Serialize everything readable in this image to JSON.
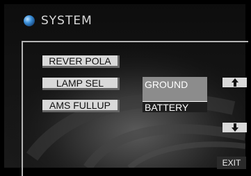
{
  "header": {
    "icon": "sphere-icon",
    "title": "SYSTEM"
  },
  "menu": {
    "rever_pola": "REVER POLA",
    "lamp_sel": "LAMP SEL",
    "ams_fullup": "AMS FULLUP"
  },
  "lamp_options": {
    "ground": "GROUND",
    "battery": "BATTERY"
  },
  "nav": {
    "up_icon": "arrow-up-icon",
    "down_icon": "arrow-down-icon",
    "exit": "EXIT"
  },
  "colors": {
    "accent_blue": "#3a8fd9",
    "button_bg": "#d9d9d9",
    "highlight": "#8c8c8c"
  }
}
